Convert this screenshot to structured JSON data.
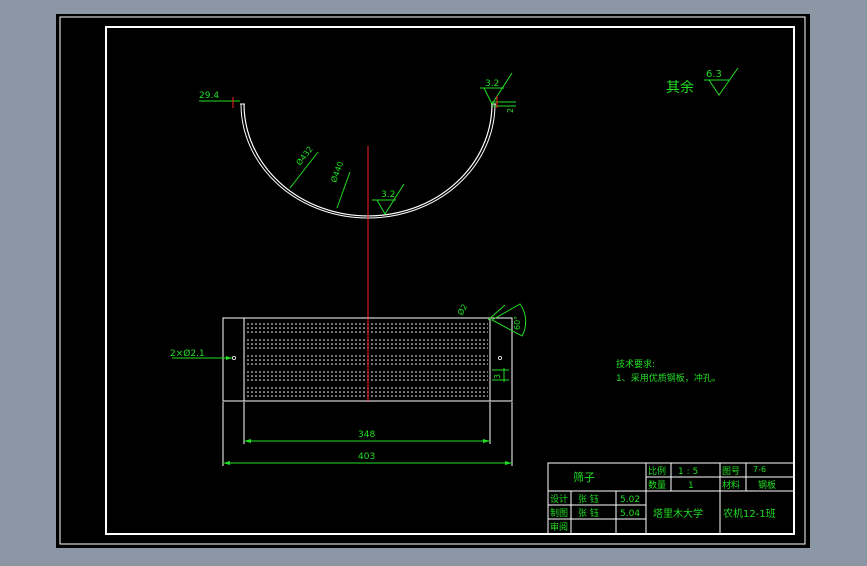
{
  "drawing": {
    "colors": {
      "background": "#000000",
      "outer_frame": "#8b97a5",
      "line_white": "#ffffff",
      "dimension_green": "#22dd22",
      "centerline_red": "#ff2020"
    },
    "top_view": {
      "dim_width_left": "29.4",
      "dim_radius_outer": "Ø432",
      "dim_radius_inner": "Ø440",
      "rough_inner": "3.2",
      "rough_top_right": "3.2",
      "dim_right_small": "2"
    },
    "rest_roughness": {
      "label": "其余",
      "value": "6.3"
    },
    "front_view": {
      "hole_spec": "2×Ø2.1",
      "dim_hole_width": "Ø2",
      "dim_right_angle": "60°",
      "dim_right_edge": "3",
      "dim_perforated_length": "348",
      "dim_total_length": "403"
    },
    "tech_notes": {
      "title": "技术要求:",
      "line1": "1、采用优质钢板，冲孔。"
    },
    "title_block": {
      "part_name": "筛子",
      "scale_label": "比例",
      "scale_value": "1 : 5",
      "drawing_no_label": "图号",
      "drawing_no_value": "7-6",
      "quantity_label": "数量",
      "quantity_value": "1",
      "material_label": "材料",
      "material_value": "钢板",
      "design_label": "设计",
      "design_name": "张  钰",
      "design_date": "5.02",
      "draw_label": "制图",
      "draw_name": "张  钰",
      "draw_date": "5.04",
      "review_label": "审阅",
      "school": "塔里木大学",
      "class": "农机12-1班"
    }
  }
}
